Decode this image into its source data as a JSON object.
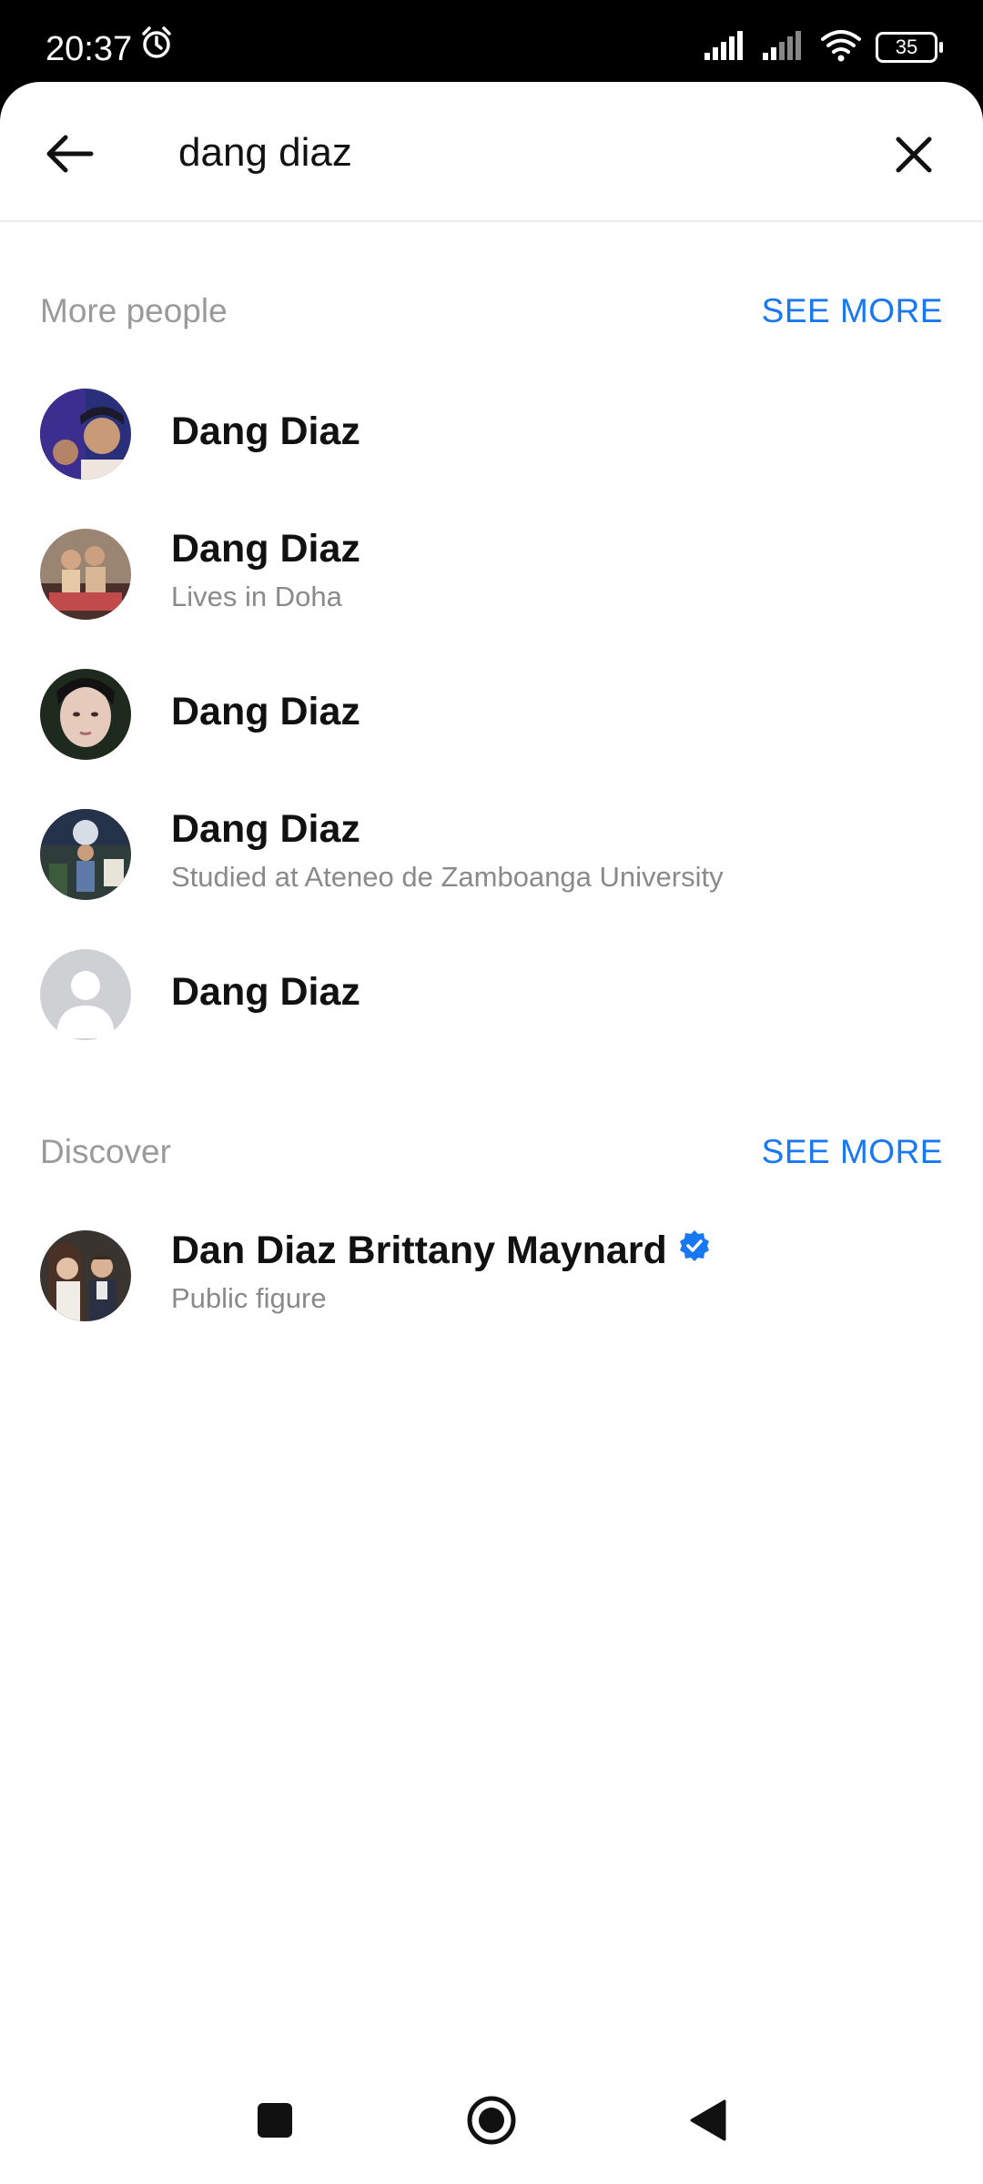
{
  "status_bar": {
    "time": "20:37",
    "battery": "35",
    "icons": [
      "alarm-icon",
      "signal-icon",
      "signal-icon",
      "wifi-icon",
      "battery-icon"
    ]
  },
  "search": {
    "query": "dang diaz",
    "back_icon": "arrow-left-icon",
    "clear_icon": "close-icon"
  },
  "more_people": {
    "title": "More people",
    "see_more": "SEE MORE",
    "items": [
      {
        "name": "Dang Diaz",
        "subtitle": ""
      },
      {
        "name": "Dang Diaz",
        "subtitle": "Lives in Doha"
      },
      {
        "name": "Dang Diaz",
        "subtitle": ""
      },
      {
        "name": "Dang Diaz",
        "subtitle": "Studied at Ateneo de Zamboanga University"
      },
      {
        "name": "Dang Diaz",
        "subtitle": ""
      }
    ]
  },
  "discover": {
    "title": "Discover",
    "see_more": "SEE MORE",
    "items": [
      {
        "name": "Dan Diaz Brittany Maynard",
        "subtitle": "Public figure",
        "verified": true
      }
    ]
  },
  "nav_bar": {
    "icons": [
      "recents-square-icon",
      "home-circle-icon",
      "back-triangle-icon"
    ]
  },
  "colors": {
    "accent": "#1877f2",
    "section_title": "#9a9a9a",
    "subtitle": "#8a8a8a",
    "text": "#111111"
  }
}
